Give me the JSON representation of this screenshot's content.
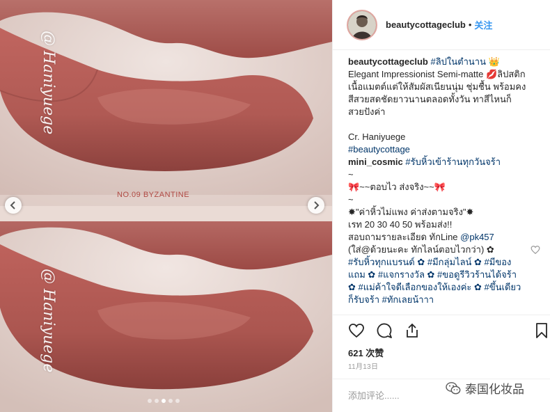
{
  "photo": {
    "watermark": "@ Haniyuege",
    "shade_caption": "NO.09  BYZANTINE",
    "carousel_dots": 5,
    "active_dot": 2
  },
  "post": {
    "username": "beautycottageclub",
    "separator": "•",
    "follow_label": "关注",
    "caption": {
      "username": "beautycottageclub",
      "hashtag_title": "#ลิปในตำนาน",
      "crown": "👑",
      "line2_prefix": "Elegant Impressionist Semi-matte ",
      "lips_emoji": "💋",
      "line2_suffix": "ลิปสติก",
      "body": "เนื้อแมตต์แต่ให้สัมผัสเนียนนุ่ม ชุ่มชื้น พร้อมคงสีสวยสดชัดยาวนานตลอดทั้งวัน ทาสีไหนก็สวยปังค่า",
      "credit": "Cr. Haniyuege",
      "hashtag_brand": "#beautycottage"
    },
    "comment": {
      "username": "mini_cosmic",
      "hashtag": "#รับหิ้วเข้าร้านทุกวันจร้า",
      "line_tilde1": "~",
      "line_bow": "🎀~~ตอบไว ส่งจริง~~🎀",
      "line_tilde2": "~",
      "line_quote": "✸\"ค่าหิ้วไม่แพง ค่าส่งตามจริง\"✸",
      "line_rate": "เรท 20 30 40 50 พร้อมส่ง!!",
      "line_contact_prefix": "สอบถามรายละเอียด ทักLine ",
      "line_contact_handle": "@pk457",
      "line_note": "(ใส่@ด้วยนะคะ ทักไลน์ตอบไวกว่า) ✿",
      "line_tags": "#รับหิ้วทุกแบรนด์ ✿ #มีกลุ่มไลน์ ✿ #มีของแถม ✿ #แจกรางวัล ✿ #ขอดูรีวิวร้านได้จร้า ✿ #แม่ค้าใจดีเลือกของให้เองค่ะ ✿ #ขึ้นเดียวก็รับจร้า #ทักเลยน้าาา"
    },
    "likes": "621 次赞",
    "date": "11月13日",
    "comment_placeholder": "添加评论......"
  },
  "wechat_brand": "泰国化妆品",
  "colors": {
    "link": "#003569",
    "follow": "#3897f0",
    "lip": "#b7625c"
  }
}
